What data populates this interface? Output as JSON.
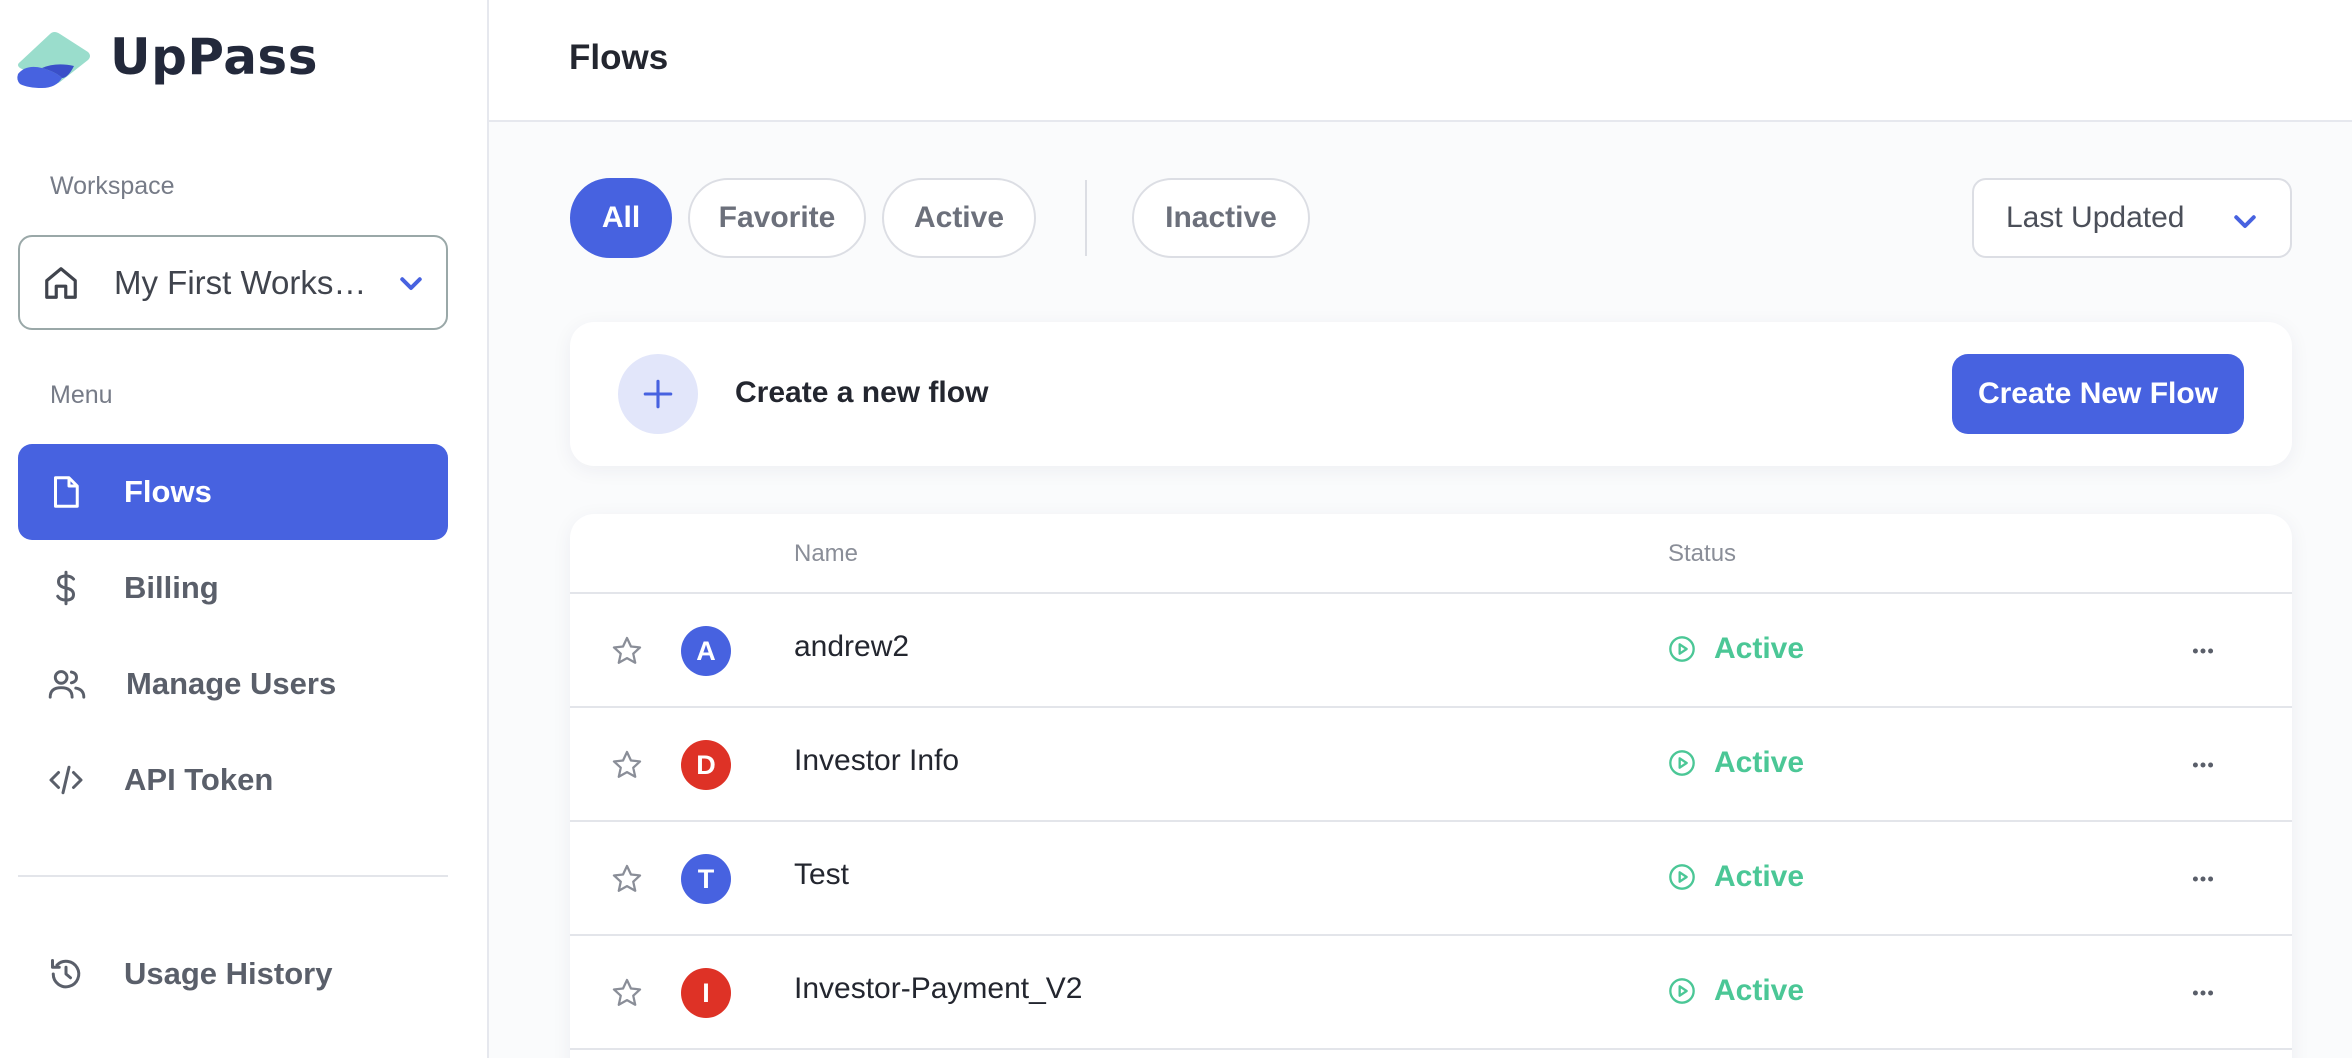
{
  "app": {
    "name": "UpPass"
  },
  "colors": {
    "primary": "#4762e0",
    "active_status": "#4bc796",
    "avatar_blue": "#4762e0",
    "avatar_red": "#de3226"
  },
  "sidebar": {
    "workspace_label": "Workspace",
    "workspace_value": "My First Workspace",
    "menu_label": "Menu",
    "items": [
      {
        "label": "Flows",
        "icon": "file-icon",
        "active": true
      },
      {
        "label": "Billing",
        "icon": "dollar-icon",
        "active": false
      },
      {
        "label": "Manage Users",
        "icon": "users-icon",
        "active": false
      },
      {
        "label": "API Token",
        "icon": "code-icon",
        "active": false
      }
    ],
    "footer_item": {
      "label": "Usage History",
      "icon": "history-icon"
    }
  },
  "header": {
    "title": "Flows"
  },
  "filters": {
    "tabs": [
      {
        "label": "All",
        "active": true
      },
      {
        "label": "Favorite",
        "active": false
      },
      {
        "label": "Active",
        "active": false
      },
      {
        "label": "Inactive",
        "active": false
      }
    ],
    "sort_value": "Last Updated"
  },
  "create_card": {
    "text": "Create a new flow",
    "button_label": "Create New Flow"
  },
  "table": {
    "columns": {
      "name": "Name",
      "status": "Status"
    },
    "rows": [
      {
        "initial": "A",
        "name": "andrew2",
        "status": "Active",
        "avatar_color": "blue"
      },
      {
        "initial": "D",
        "name": "Investor Info",
        "status": "Active",
        "avatar_color": "red"
      },
      {
        "initial": "T",
        "name": "Test",
        "status": "Active",
        "avatar_color": "blue"
      },
      {
        "initial": "I",
        "name": "Investor-Payment_V2",
        "status": "Active",
        "avatar_color": "red"
      }
    ]
  }
}
